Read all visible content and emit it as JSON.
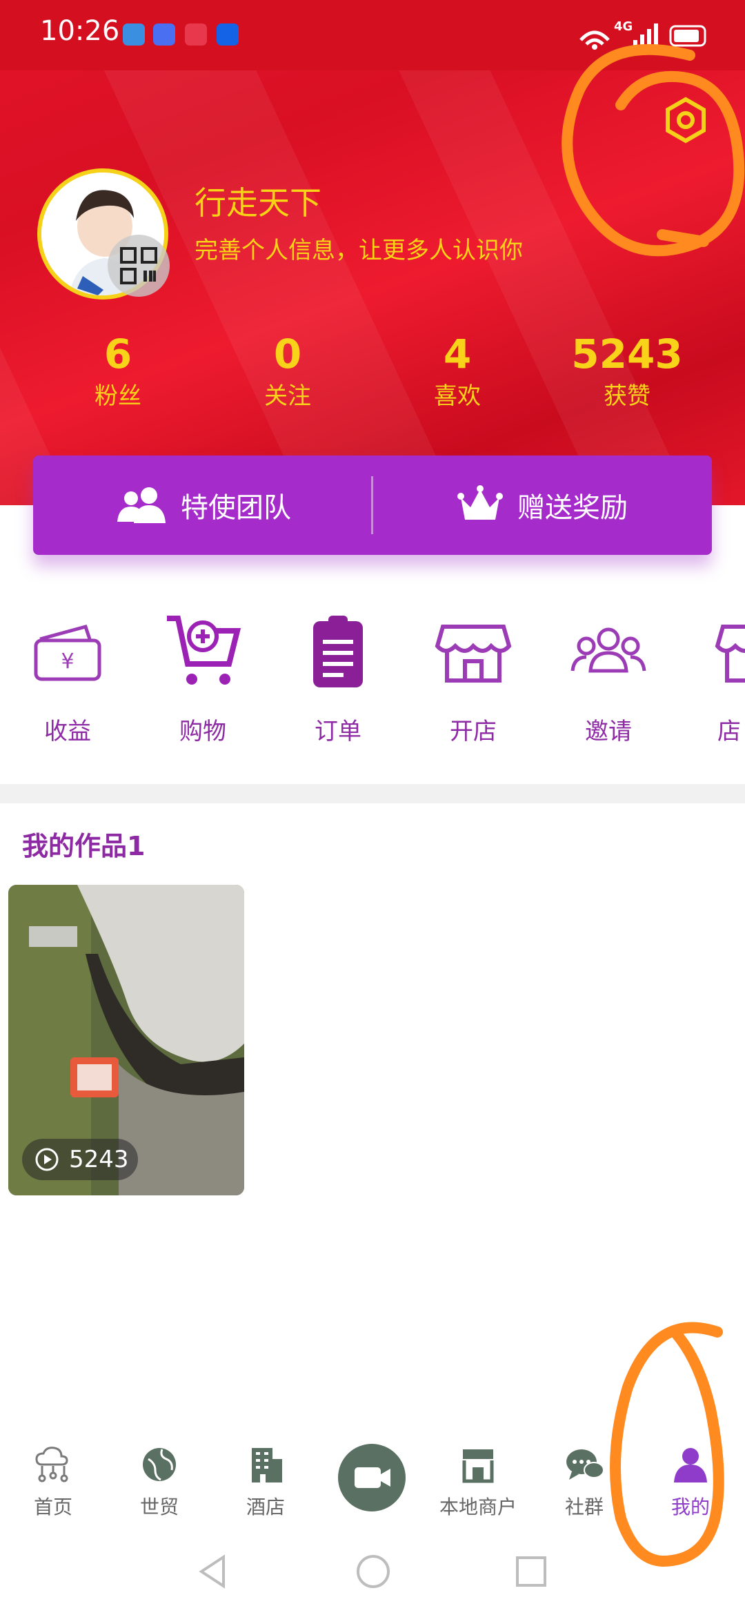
{
  "status_bar": {
    "time": "10:26",
    "network": "4G"
  },
  "profile": {
    "username": "行走天下",
    "subtitle": "完善个人信息，让更多人认识你"
  },
  "stats": [
    {
      "value": "6",
      "label": "粉丝"
    },
    {
      "value": "0",
      "label": "关注"
    },
    {
      "value": "4",
      "label": "喜欢"
    },
    {
      "value": "5243",
      "label": "获赞"
    }
  ],
  "action_bar": {
    "team_label": "特使团队",
    "reward_label": "赠送奖励"
  },
  "grid": [
    {
      "label": "收益",
      "icon": "ticket-yen-icon"
    },
    {
      "label": "购物",
      "icon": "cart-plus-icon"
    },
    {
      "label": "订单",
      "icon": "order-list-icon"
    },
    {
      "label": "开店",
      "icon": "store-icon"
    },
    {
      "label": "邀请",
      "icon": "people-group-icon"
    },
    {
      "label": "店",
      "icon": "store-icon"
    }
  ],
  "works": {
    "title": "我的作品1",
    "items": [
      {
        "play_count": "5243"
      }
    ]
  },
  "bottom_nav": [
    {
      "label": "首页",
      "icon": "cloud-network-icon"
    },
    {
      "label": "世贸",
      "icon": "globe-icon"
    },
    {
      "label": "酒店",
      "icon": "building-icon"
    },
    {
      "label": "",
      "icon": "video-camera-icon"
    },
    {
      "label": "本地商户",
      "icon": "shop-icon"
    },
    {
      "label": "社群",
      "icon": "chat-bubbles-icon"
    },
    {
      "label": "我的",
      "icon": "person-icon",
      "active": true
    }
  ],
  "colors": {
    "header_red": "#e3142a",
    "gold": "#f7d416",
    "purple": "#a52ccb",
    "label_purple": "#8f2aa6",
    "annotation_orange": "#ff8a1f"
  }
}
